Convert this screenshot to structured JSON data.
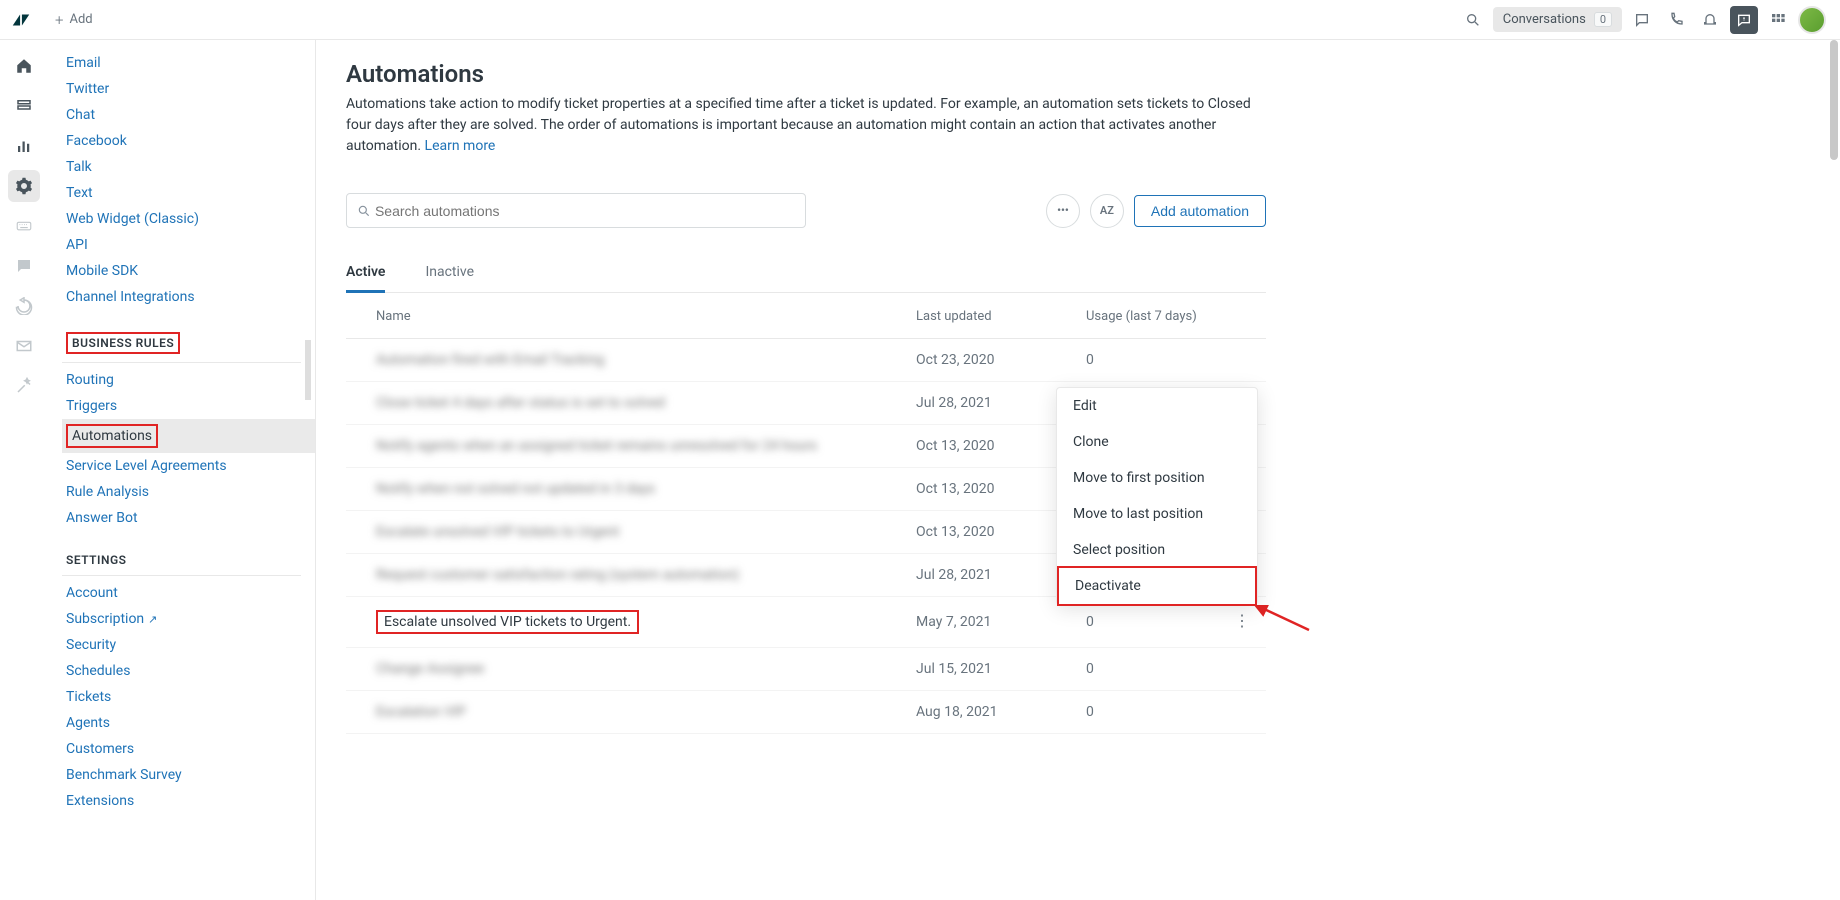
{
  "topbar": {
    "add_label": "Add",
    "conversations_label": "Conversations",
    "conversations_count": "0"
  },
  "sidebar": {
    "channels": [
      "Email",
      "Twitter",
      "Chat",
      "Facebook",
      "Talk",
      "Text",
      "Web Widget (Classic)",
      "API",
      "Mobile SDK",
      "Channel Integrations"
    ],
    "section_business": "BUSINESS RULES",
    "business_items": [
      "Routing",
      "Triggers",
      "Automations",
      "Service Level Agreements",
      "Rule Analysis",
      "Answer Bot"
    ],
    "section_settings": "SETTINGS",
    "settings_items": [
      "Account",
      "Subscription",
      "Security",
      "Schedules",
      "Tickets",
      "Agents",
      "Customers",
      "Benchmark Survey",
      "Extensions"
    ]
  },
  "main": {
    "title": "Automations",
    "description": "Automations take action to modify ticket properties at a specified time after a ticket is updated. For example, an automation sets tickets to Closed four days after they are solved. The order of automations is important because an automation might contain an action that activates another automation. ",
    "learn_more": "Learn more",
    "search_placeholder": "Search automations",
    "sort_label": "AZ",
    "add_button": "Add automation",
    "tabs": {
      "active": "Active",
      "inactive": "Inactive"
    },
    "columns": {
      "name": "Name",
      "updated": "Last updated",
      "usage": "Usage (last 7 days)"
    },
    "rows": [
      {
        "name": "Automation fired with Email Tracking",
        "updated": "Oct 23, 2020",
        "usage": "0",
        "blur": true
      },
      {
        "name": "Close ticket 4 days after status is set to solved",
        "updated": "Jul 28, 2021",
        "usage": "",
        "blur": true
      },
      {
        "name": "Notify agents when an assigned ticket remains unresolved for 24 hours",
        "updated": "Oct 13, 2020",
        "usage": "",
        "blur": true
      },
      {
        "name": "Notify when not solved not updated in 3 days",
        "updated": "Oct 13, 2020",
        "usage": "",
        "blur": true
      },
      {
        "name": "Escalate unsolved VIP tickets to Urgent",
        "updated": "Oct 13, 2020",
        "usage": "",
        "blur": true
      },
      {
        "name": "Request customer satisfaction rating (system automation)",
        "updated": "Jul 28, 2021",
        "usage": "",
        "blur": true
      },
      {
        "name": "Escalate unsolved VIP tickets to Urgent.",
        "updated": "May 7, 2021",
        "usage": "0",
        "blur": false,
        "highlight": true,
        "open_menu": true
      },
      {
        "name": "Change Assignee",
        "updated": "Jul 15, 2021",
        "usage": "0",
        "blur": true
      },
      {
        "name": "Escalation VIP",
        "updated": "Aug 18, 2021",
        "usage": "0",
        "blur": true
      }
    ],
    "menu": [
      "Edit",
      "Clone",
      "Move to first position",
      "Move to last position",
      "Select position",
      "Deactivate"
    ]
  }
}
